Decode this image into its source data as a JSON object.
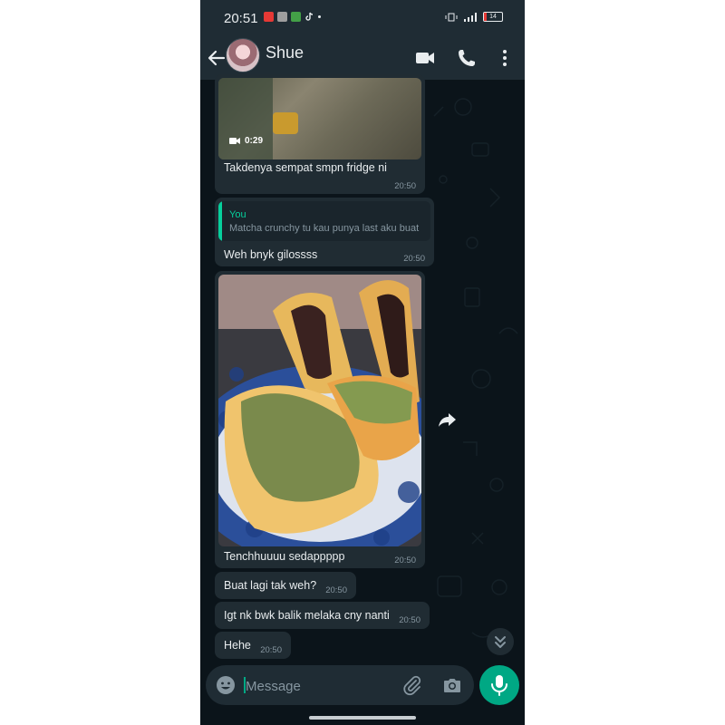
{
  "status_bar": {
    "time": "20:51",
    "battery_level": "14"
  },
  "header": {
    "contact_name": "Shue"
  },
  "messages": [
    {
      "type": "video",
      "duration": "0:29",
      "caption": "Takdenya sempat smpn fridge ni",
      "time": "20:50"
    },
    {
      "type": "reply",
      "quote_author": "You",
      "quote_text": "Matcha crunchy tu kau punya last aku buat",
      "text": "Weh bnyk gilossss",
      "time": "20:50"
    },
    {
      "type": "image",
      "caption": "Tenchhuuuu sedappppp",
      "time": "20:50"
    },
    {
      "type": "text",
      "text": "Buat lagi tak weh?",
      "time": "20:50"
    },
    {
      "type": "text",
      "text": "Igt nk bwk balik melaka cny nanti",
      "time": "20:50"
    },
    {
      "type": "text",
      "text": "Hehe",
      "time": "20:50"
    }
  ],
  "composer": {
    "placeholder": "Message"
  },
  "colors": {
    "background": "#0b141a",
    "bar": "#1f2c34",
    "incoming_bubble": "#202c33",
    "accent": "#00a884",
    "quote_accent": "#06cf9c",
    "text": "#e9edef",
    "muted_text": "#8696a0"
  },
  "icons": {
    "back": "arrow-left-icon",
    "video_call": "video-camera-icon",
    "voice_call": "phone-icon",
    "menu": "more-vertical-icon",
    "forward": "forward-arrow-icon",
    "scroll_down": "double-chevron-down-icon",
    "emoji": "emoji-icon",
    "attach": "paperclip-icon",
    "camera": "camera-icon",
    "mic": "microphone-icon"
  }
}
